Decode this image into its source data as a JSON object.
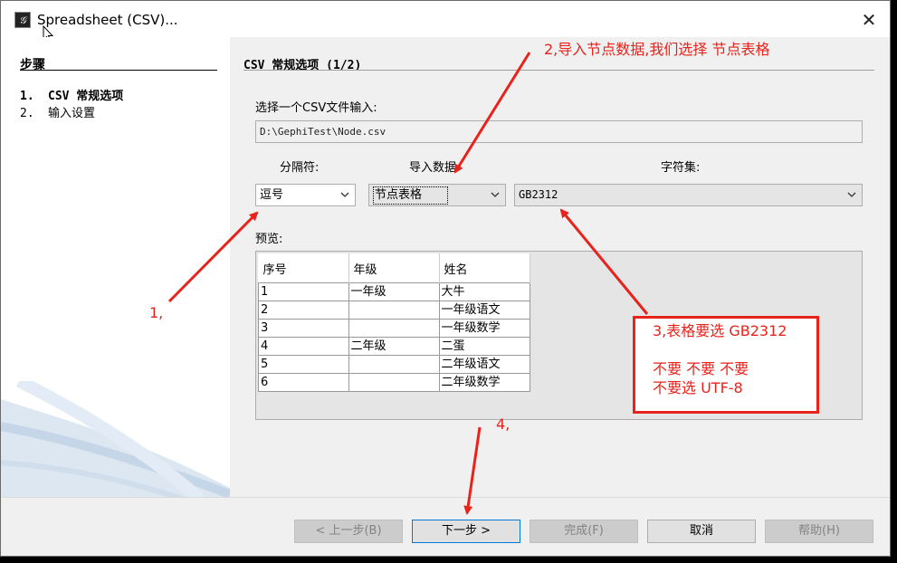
{
  "window": {
    "title": "Spreadsheet (CSV)...",
    "close_glyph": "✕"
  },
  "steps": {
    "title": "步骤",
    "items": [
      {
        "num": "1.",
        "label": "CSV 常规选项"
      },
      {
        "num": "2.",
        "label": "输入设置"
      }
    ]
  },
  "main": {
    "section_title": "CSV 常规选项 (1/2)",
    "file_prompt": "选择一个CSV文件输入:",
    "file_path": "D:\\GephiTest\\Node.csv",
    "separator_label": "分隔符:",
    "import_label": "导入数据",
    "charset_label": "字符集:",
    "separator_value": "逗号",
    "import_value": "节点表格",
    "charset_value": "GB2312",
    "preview_label": "预览:",
    "preview_headers": [
      "序号",
      "年级",
      "姓名"
    ],
    "preview_rows": [
      [
        "1",
        "一年级",
        "大牛"
      ],
      [
        "2",
        "",
        "一年级语文"
      ],
      [
        "3",
        "",
        "一年级数学"
      ],
      [
        "4",
        "二年级",
        "二蛋"
      ],
      [
        "5",
        "",
        "二年级语文"
      ],
      [
        "6",
        "",
        "二年级数学"
      ]
    ]
  },
  "footer": {
    "prev": "< 上一步(B)",
    "next": "下一步 >",
    "finish": "完成(F)",
    "cancel": "取消",
    "help": "帮助(H)"
  },
  "annotations": {
    "a1": "1,",
    "a2": "2,导入节点数据,我们选择 节点表格",
    "a3_line1": "3,表格要选 GB2312",
    "a3_line2": "不要 不要 不要",
    "a3_line3": "不要选 UTF-8",
    "a4": "4,",
    "color": "#e8231c"
  },
  "icons": {
    "chevron": "chevron-down-icon",
    "app": "gephi-icon",
    "close": "close-icon"
  }
}
